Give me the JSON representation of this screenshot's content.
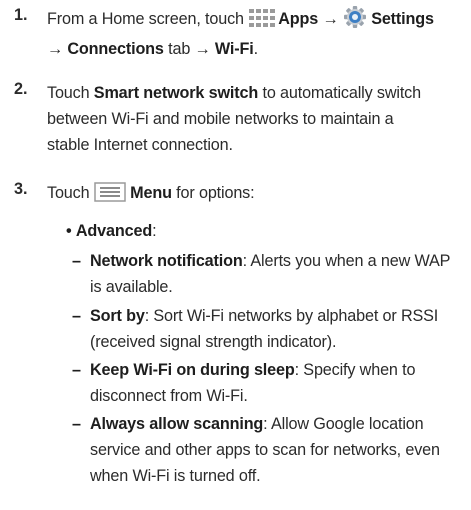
{
  "steps": [
    {
      "number": "1.",
      "line1_pre": "From a Home screen, touch ",
      "apps_label": "Apps",
      "arrow1": " → ",
      "settings_label": "Settings",
      "line2_arrow": "→ ",
      "connections_label": "Connections",
      "tab_word": " tab ",
      "arrow3": "→ ",
      "wifi_label": "Wi-Fi",
      "period": "."
    },
    {
      "number": "2.",
      "pre": "Touch ",
      "bold": "Smart network switch",
      "line1_post": " to automatically switch",
      "line2": "between Wi-Fi and mobile networks to maintain a",
      "line3": "stable Internet connection."
    },
    {
      "number": "3.",
      "pre": "Touch ",
      "bold": "Menu",
      "post": " for options:"
    }
  ],
  "advanced": {
    "bullet": "•",
    "label": "Advanced",
    "colon": ":"
  },
  "sub_items": [
    {
      "dash": "–",
      "bold": "Network notification",
      "line1_post": ": Alerts you when a new WAP",
      "line2": "is available."
    },
    {
      "dash": "–",
      "bold": "Sort by",
      "line1_post": ": Sort Wi-Fi networks by alphabet or RSSI",
      "line2": "(received signal strength indicator)."
    },
    {
      "dash": "–",
      "bold": "Keep Wi-Fi on during sleep",
      "line1_post": ": Specify when to",
      "line2": "disconnect from Wi-Fi."
    },
    {
      "dash": "–",
      "bold": "Always allow scanning",
      "line1_post": ": Allow Google location",
      "line2": "service and other apps to scan for networks, even",
      "line3": "when Wi-Fi is turned off."
    }
  ],
  "icons": {
    "apps": "apps-grid-icon",
    "settings": "settings-gear-icon",
    "menu": "menu-lines-icon"
  },
  "colors": {
    "text": "#2b2b2b",
    "icon_blue": "#3d7fc4",
    "icon_gray": "#9a9a9a"
  }
}
